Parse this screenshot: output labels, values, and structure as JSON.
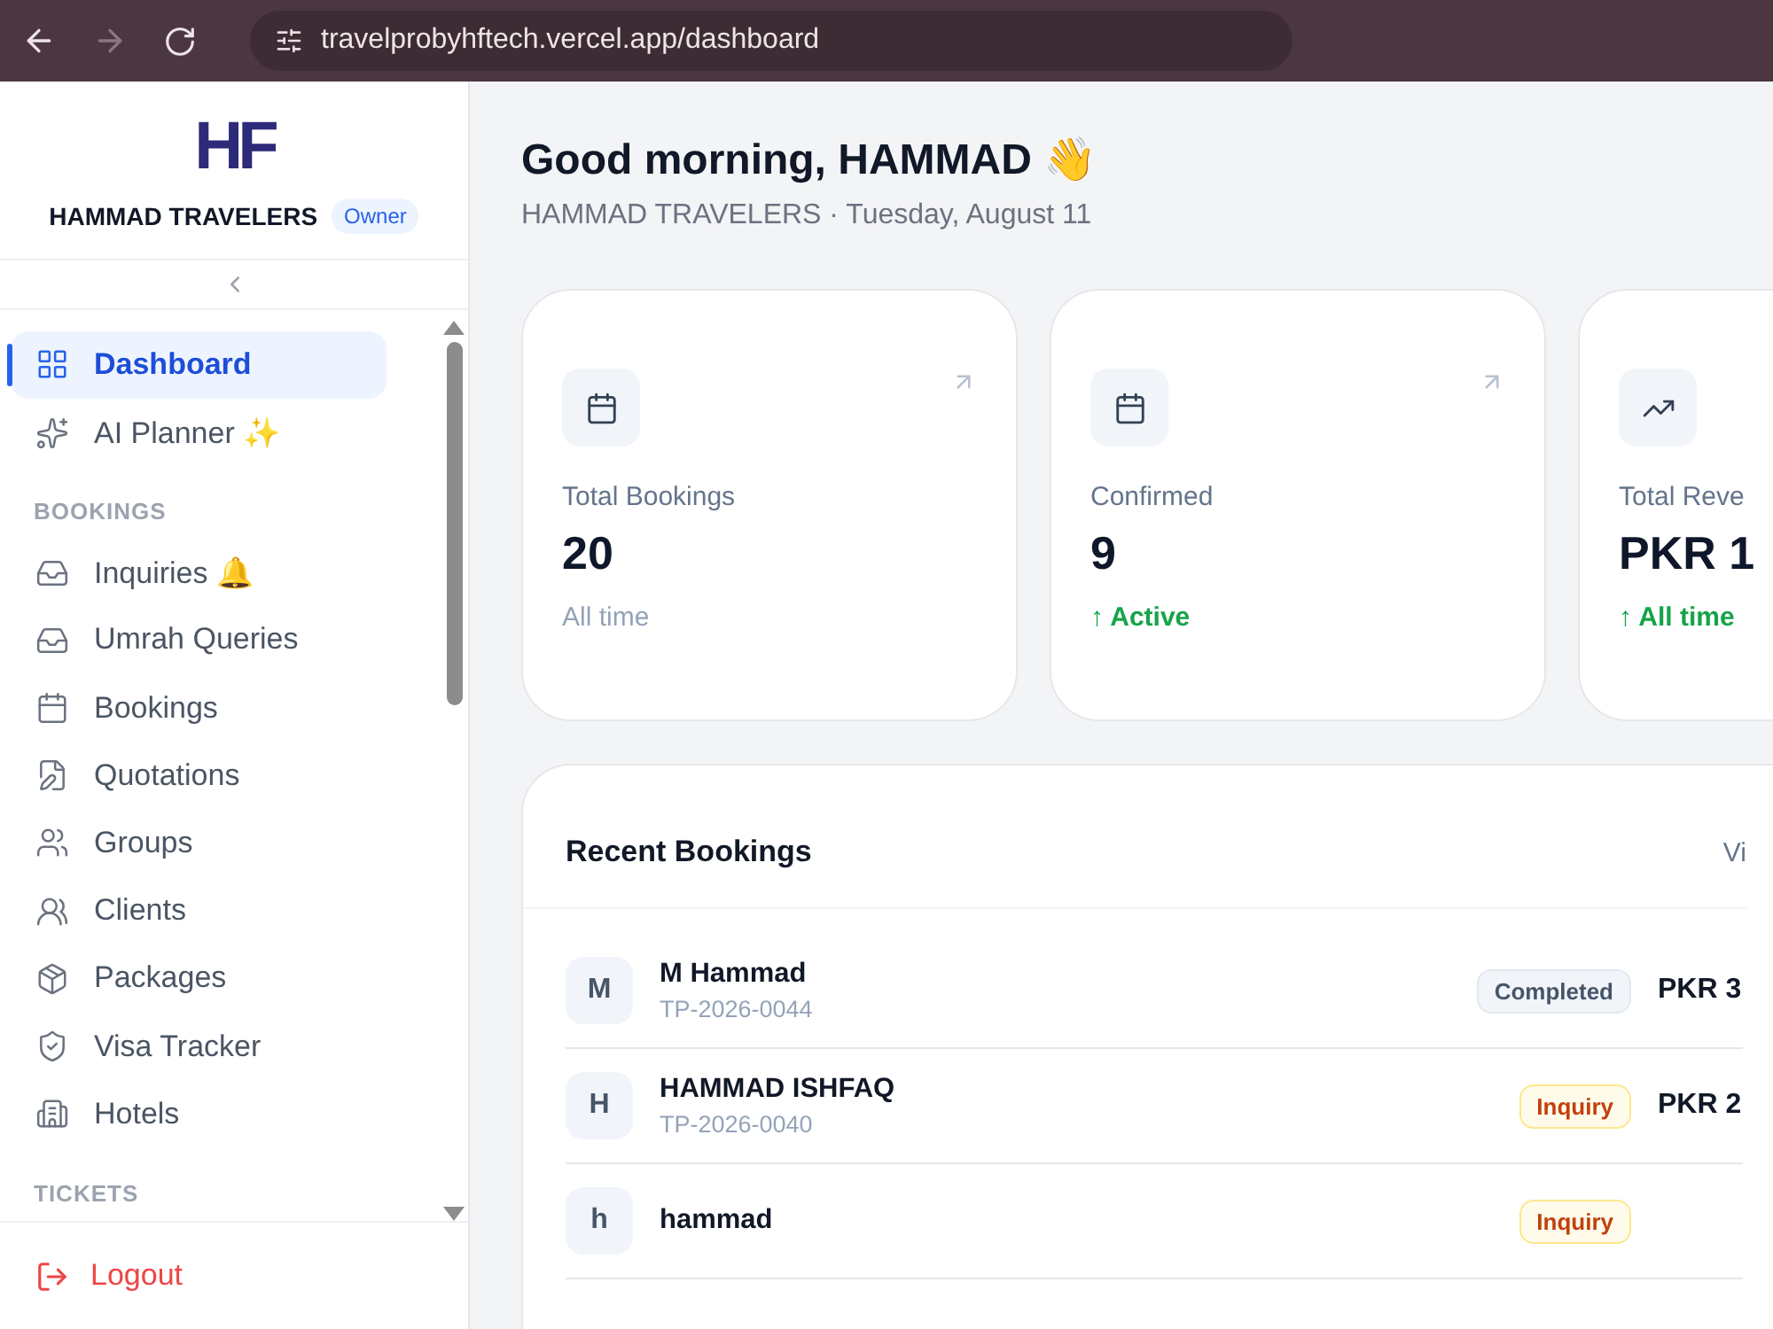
{
  "browser": {
    "url": "travelprobyhftech.vercel.app/dashboard",
    "forward_disabled": true
  },
  "sidebar": {
    "logo": "HF",
    "company": "HAMMAD TRAVELERS",
    "role": "Owner",
    "items": [
      {
        "kind": "item",
        "label": "Dashboard",
        "selected": true
      },
      {
        "kind": "item",
        "label": "AI Planner ✨",
        "selected": false
      },
      {
        "kind": "section",
        "label": "BOOKINGS"
      },
      {
        "kind": "item",
        "label": "Inquiries 🔔",
        "selected": false
      },
      {
        "kind": "item",
        "label": "Umrah Queries",
        "selected": false
      },
      {
        "kind": "item",
        "label": "Bookings",
        "selected": false
      },
      {
        "kind": "item",
        "label": "Quotations",
        "selected": false
      },
      {
        "kind": "item",
        "label": "Groups",
        "selected": false
      },
      {
        "kind": "item",
        "label": "Clients",
        "selected": false
      },
      {
        "kind": "item",
        "label": "Packages",
        "selected": false
      },
      {
        "kind": "item",
        "label": "Visa Tracker",
        "selected": false
      },
      {
        "kind": "item",
        "label": "Hotels",
        "selected": false
      },
      {
        "kind": "section",
        "label": "TICKETS"
      }
    ],
    "logout": "Logout"
  },
  "greeting": "Good morning, HAMMAD 👋",
  "subtitle": "HAMMAD TRAVELERS · Tuesday, August 11",
  "stats": [
    {
      "link": true,
      "label": "Total Bookings",
      "value": "20",
      "note": "All time",
      "positive": false
    },
    {
      "link": true,
      "label": "Confirmed",
      "value": "9",
      "note": "↑ Active",
      "positive": true
    },
    {
      "link": false,
      "label": "Total Reve",
      "value": "PKR 1",
      "note": "↑ All time",
      "positive": true
    }
  ],
  "recent": {
    "title": "Recent Bookings",
    "action": "Vi",
    "rows": [
      {
        "initial": "M",
        "name": "M Hammad",
        "ref": "TP-2026-0044",
        "status": "Completed",
        "kind": "completed",
        "amount": "PKR 3"
      },
      {
        "initial": "H",
        "name": "HAMMAD ISHFAQ",
        "ref": "TP-2026-0040",
        "status": "Inquiry",
        "kind": "inquiry",
        "amount": "PKR 2"
      },
      {
        "initial": "h",
        "name": "hammad",
        "status": "Inquiry",
        "kind": "inquiry"
      }
    ]
  }
}
